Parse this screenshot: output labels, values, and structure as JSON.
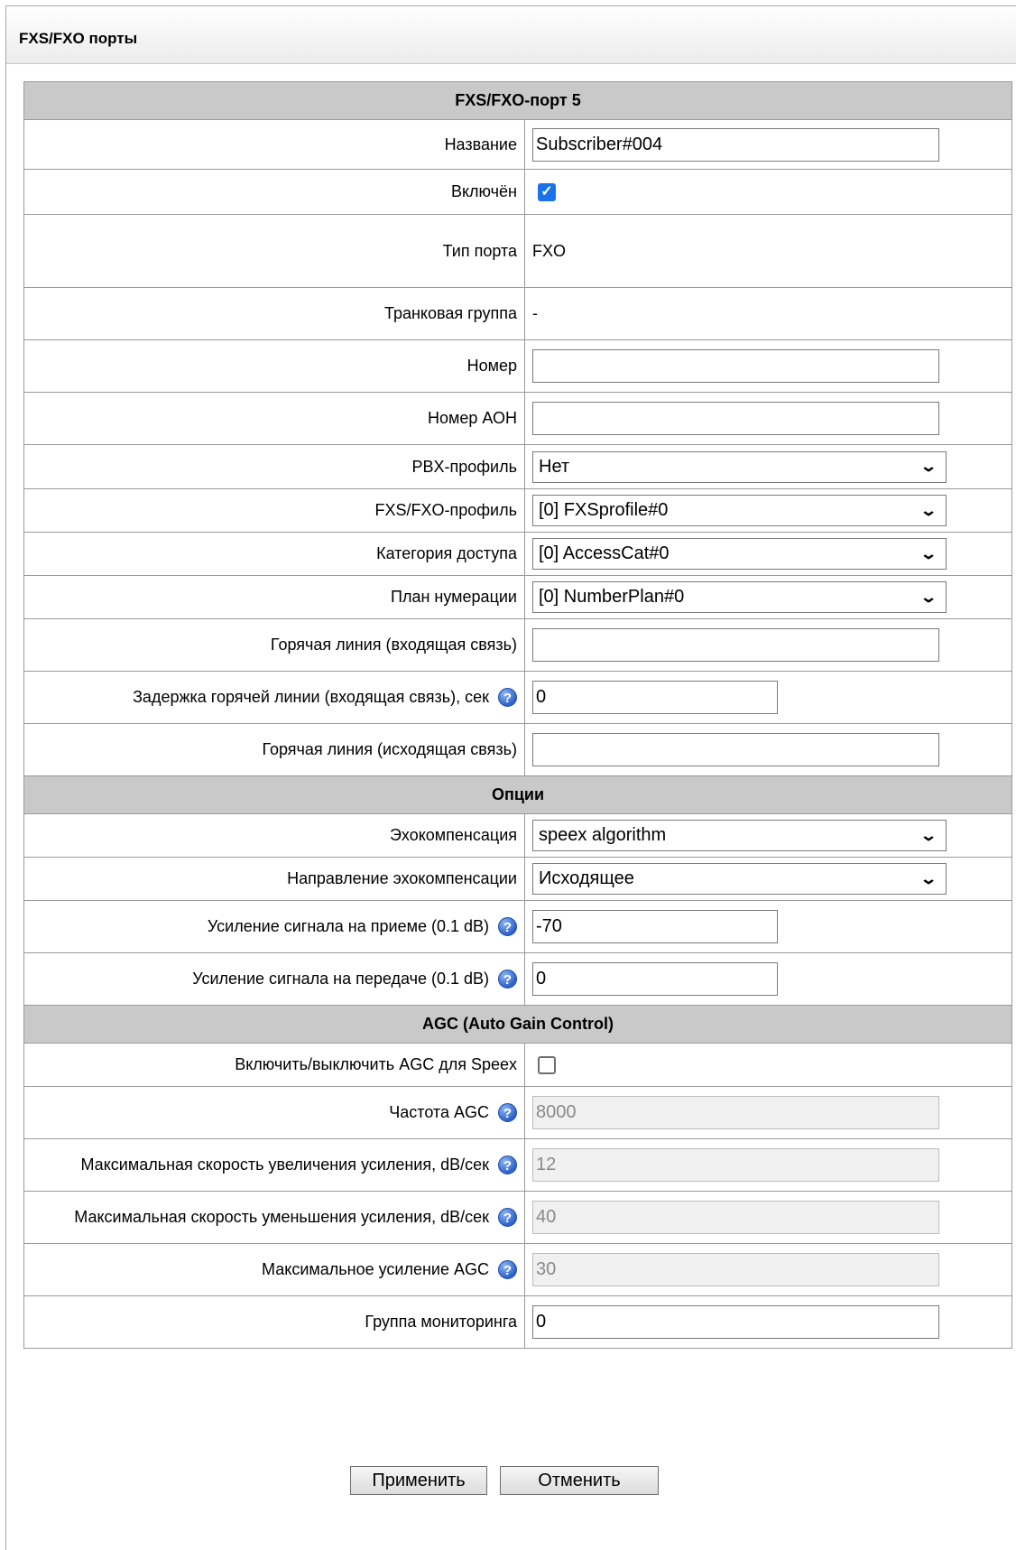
{
  "page": {
    "title": "FXS/FXO порты"
  },
  "sections": {
    "port": "FXS/FXO-порт 5",
    "options": "Опции",
    "agc": "AGC (Auto Gain Control)"
  },
  "fields": {
    "name": {
      "label": "Название",
      "value": "Subscriber#004"
    },
    "enabled": {
      "label": "Включён",
      "checked": true,
      "check_glyph": "✓"
    },
    "port_type": {
      "label": "Тип порта",
      "value": "FXO"
    },
    "trunk_group": {
      "label": "Транковая группа",
      "value": "-"
    },
    "number": {
      "label": "Номер",
      "value": ""
    },
    "aon_number": {
      "label": "Номер АОН",
      "value": ""
    },
    "pbx_profile": {
      "label": "PBX-профиль",
      "value": "Нет"
    },
    "fxs_profile": {
      "label": "FXS/FXO-профиль",
      "value": "[0] FXSprofile#0"
    },
    "access_category": {
      "label": "Категория доступа",
      "value": "[0] AccessCat#0"
    },
    "numbering_plan": {
      "label": "План нумерации",
      "value": "[0] NumberPlan#0"
    },
    "hotline_in": {
      "label": "Горячая линия (входящая связь)",
      "value": ""
    },
    "hotline_delay": {
      "label": "Задержка горячей линии (входящая связь), сек",
      "value": "0"
    },
    "hotline_out": {
      "label": "Горячая линия (исходящая связь)",
      "value": ""
    },
    "echo_cancel": {
      "label": "Эхокомпенсация",
      "value": "speex algorithm"
    },
    "echo_direction": {
      "label": "Направление эхокомпенсации",
      "value": "Исходящее"
    },
    "rx_gain": {
      "label": "Усиление сигнала на приеме (0.1 dB)",
      "value": "-70"
    },
    "tx_gain": {
      "label": "Усиление сигнала на передаче (0.1 dB)",
      "value": "0"
    },
    "agc_speex": {
      "label": "Включить/выключить AGC для Speex",
      "checked": false
    },
    "agc_freq": {
      "label": "Частота AGC",
      "value": "8000"
    },
    "agc_inc_speed": {
      "label": "Максимальная скорость увеличения усиления, dB/сек",
      "value": "12"
    },
    "agc_dec_speed": {
      "label": "Максимальная скорость уменьшения усиления, dB/сек",
      "value": "40"
    },
    "agc_max_gain": {
      "label": "Максимальное усиление AGC",
      "value": "30"
    },
    "monitor_group": {
      "label": "Группа мониторинга",
      "value": "0"
    }
  },
  "help_glyph": "?",
  "select_chevron": "⌄",
  "buttons": {
    "apply": "Применить",
    "cancel": "Отменить"
  },
  "icons": {
    "help": "help-icon",
    "dropdown": "chevron-down-icon",
    "check": "checkmark-icon"
  },
  "colors": {
    "section_bg": "#c9c9c9",
    "checkbox_accent": "#1a73e8",
    "help_icon": "#2c62c9"
  }
}
